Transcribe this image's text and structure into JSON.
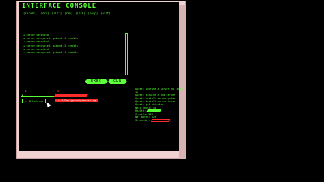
{
  "console": {
    "title": "INTERFACE CONSOLE",
    "menu": [
      "[server]",
      "[dock]",
      "[list]",
      "[raw]",
      "[lock]",
      "[help]",
      "[exit]"
    ]
  },
  "log": [
    "+ server detected",
    "+ server decrypted, gained 40 credits",
    "+ server detected",
    "+ server decrypted, gained 40 credits",
    "+ server detected",
    "+ server decrypted, gained 40 credits"
  ],
  "buttons": {
    "exec": "EXEC",
    "clear": "CLR"
  },
  "nodes": {
    "left": {
      "id": "B",
      "name": "Lv 8 Defense",
      "color": "#55ff33"
    },
    "right": {
      "id": "A",
      "name": "Lv 8 Decryptor/processing",
      "color": "#ff2a2a"
    }
  },
  "quest": {
    "lines": [
      "Quest: upgrade a server to level",
      "12",
      "Quest: acquire a 3rd server",
      "Quest: install an encryptor",
      "Quest: install an ice server",
      "Quest: get attacked",
      "Next level: 40"
    ],
    "bars": [
      {
        "label": "Health:",
        "kind": "filled",
        "color": "#55ff33"
      },
      {
        "label": "Credits: 228",
        "kind": "none"
      },
      {
        "label": "Net Worth: 329",
        "kind": "none"
      },
      {
        "label": "Intensity:",
        "kind": "outline",
        "color": "#ff2a2a"
      }
    ]
  }
}
